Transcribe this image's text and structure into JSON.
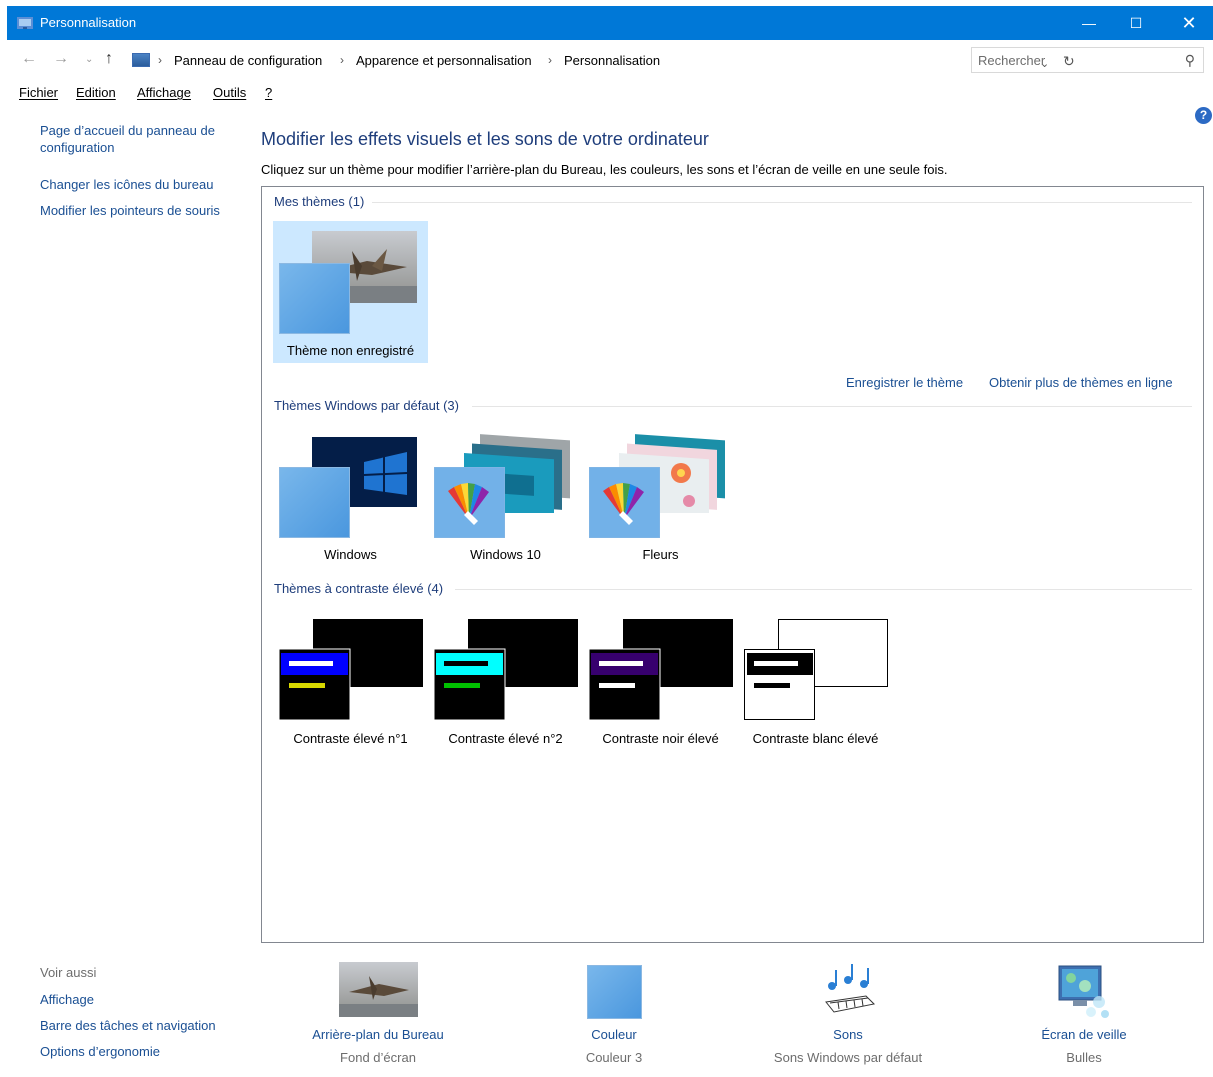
{
  "window": {
    "title": "Personnalisation",
    "accent": "#0078d7"
  },
  "address": {
    "crumbs": [
      "Panneau de configuration",
      "Apparence et personnalisation",
      "Personnalisation"
    ],
    "search_placeholder": "Rechercher"
  },
  "menu": [
    "Fichier",
    "Edition",
    "Affichage",
    "Outils",
    "?"
  ],
  "sidebar": {
    "home_link": "Page d’accueil du panneau de configuration",
    "links": [
      "Changer les icônes du bureau",
      "Modifier les pointeurs de souris"
    ],
    "see_also_label": "Voir aussi",
    "see_also": [
      "Affichage",
      "Barre des tâches et navigation",
      "Options d’ergonomie"
    ]
  },
  "main": {
    "title": "Modifier les effets visuels et les sons de votre ordinateur",
    "description": "Cliquez sur un thème pour modifier l’arrière-plan du Bureau, les couleurs, les sons et l’écran de veille en une seule fois.",
    "save_theme": "Enregistrer le thème",
    "more_themes": "Obtenir plus de thèmes en ligne",
    "groups": [
      {
        "header": "Mes thèmes (1)",
        "themes": [
          "Thème non enregistré"
        ]
      },
      {
        "header": "Thèmes Windows par défaut (3)",
        "themes": [
          "Windows",
          "Windows 10",
          "Fleurs"
        ]
      },
      {
        "header": "Thèmes à contraste élevé (4)",
        "themes": [
          "Contraste élevé n°1",
          "Contraste élevé n°2",
          "Contraste noir élevé",
          "Contraste blanc élevé"
        ]
      }
    ]
  },
  "bottom": [
    {
      "title": "Arrière-plan du Bureau",
      "subtitle": "Fond d’écran",
      "icon": "wallpaper-icon"
    },
    {
      "title": "Couleur",
      "subtitle": "Couleur 3",
      "icon": "color-icon"
    },
    {
      "title": "Sons",
      "subtitle": "Sons Windows par défaut",
      "icon": "sounds-icon"
    },
    {
      "title": "Écran de veille",
      "subtitle": "Bulles",
      "icon": "screensaver-icon"
    }
  ]
}
